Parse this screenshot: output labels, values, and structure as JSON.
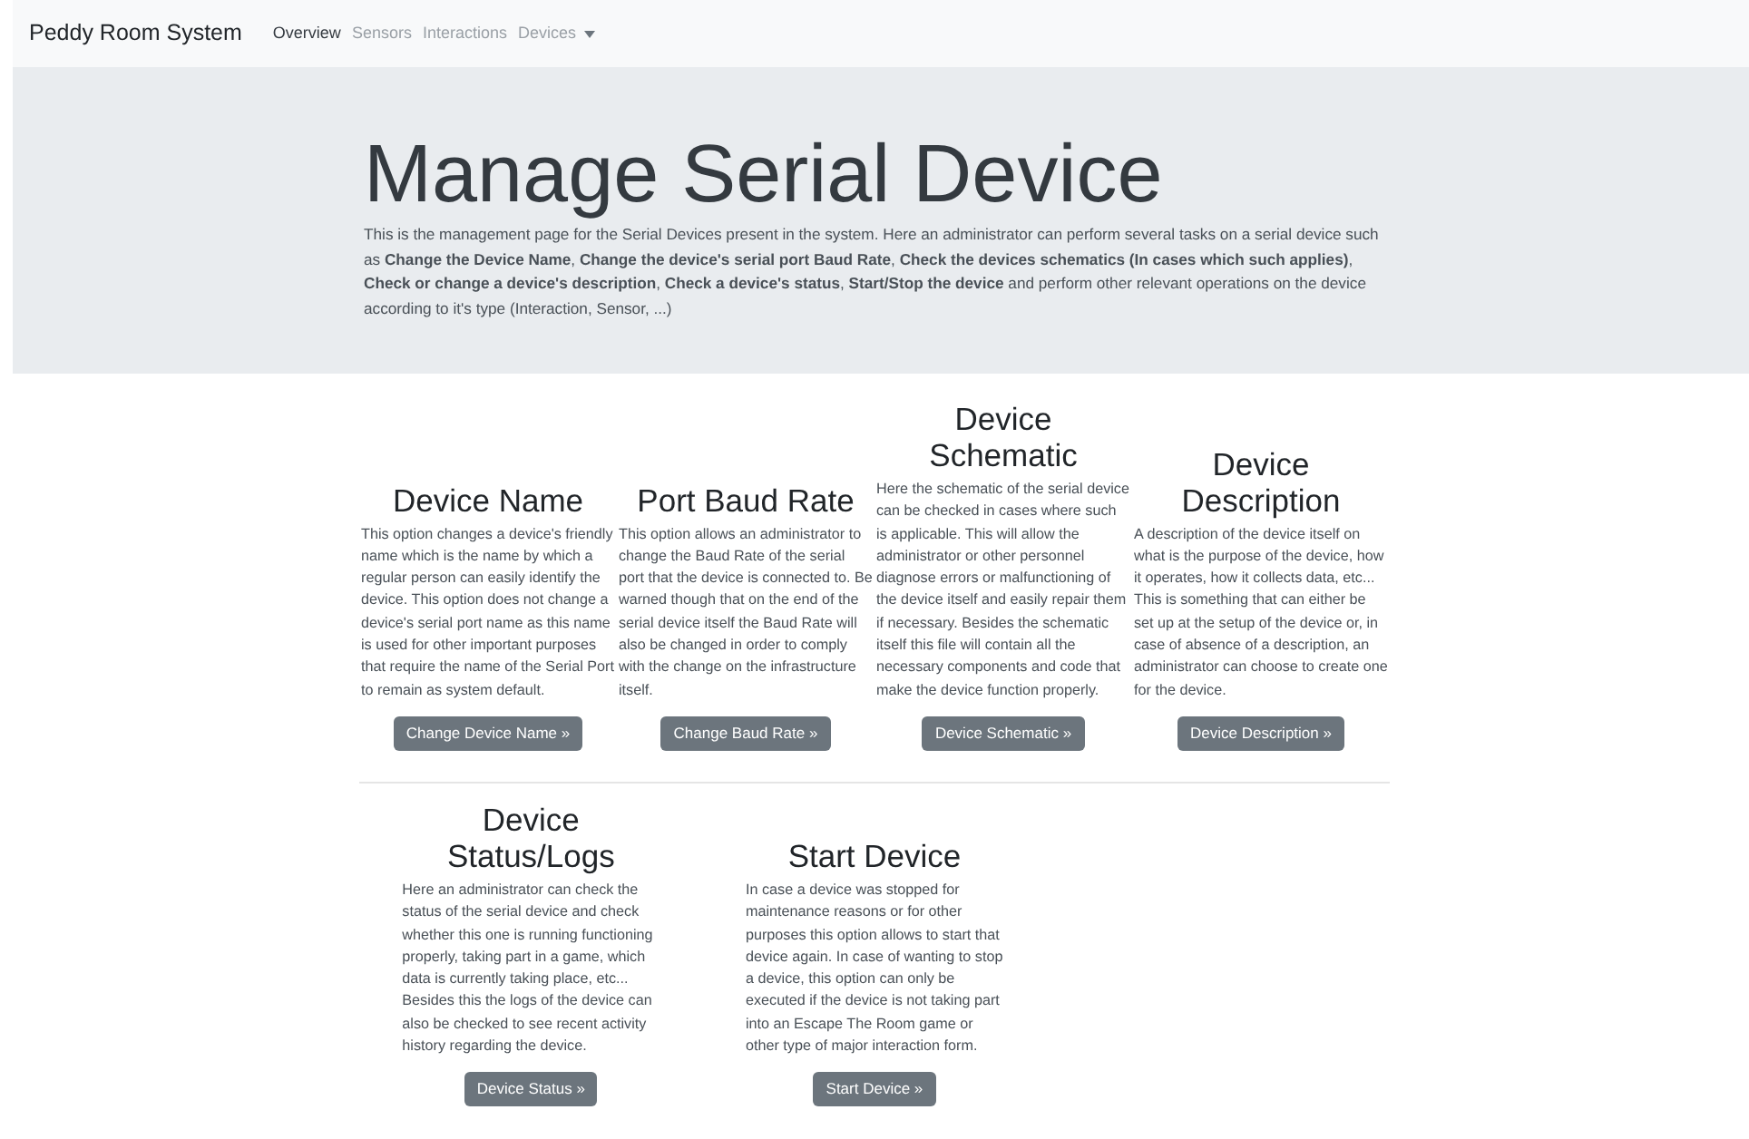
{
  "navbar": {
    "brand": "Peddy Room System",
    "items": [
      {
        "label": "Overview",
        "selected": true,
        "kind": "link"
      },
      {
        "label": "Sensors",
        "selected": false,
        "kind": "link"
      },
      {
        "label": "Interactions",
        "selected": false,
        "kind": "link"
      },
      {
        "label": "Devices",
        "selected": false,
        "kind": "dropdown"
      }
    ]
  },
  "jumbotron": {
    "title": "Manage Serial Device",
    "description": "This is the management page for the Serial Devices present in the system. Here an administrator can perform several tasks on a serial device such as **Change the Device Name**, **Change the device's serial port Baud Rate**, **Check the devices schematics (In cases which such applies)**, **Check or change a device's description**, **Check a device's status**, **Start/Stop the device** and perform other relevant operations on the device according to it's type (Interaction, Sensor, ...)"
  },
  "option_rows": [
    [
      {
        "heading": "Device Name",
        "text": "This option changes a device's friendly name which is the name by which a regular person can easily identify the device. This option does not change a device's serial port name as this name is used for other important purposes that require the name of the Serial Port to remain as system default.",
        "button": "Change Device Name »"
      },
      {
        "heading": "Port Baud Rate",
        "text": "This option allows an administrator to change the Baud Rate of the serial port that the device is connected to. Be warned though that on the end of the serial device itself the Baud Rate will also be changed in order to comply with the change on the infrastructure itself.",
        "button": "Change Baud Rate »"
      },
      {
        "heading": "Device Schematic",
        "text": "Here the schematic of the serial device can be checked in cases where such is applicable. This will allow the administrator or other personnel diagnose errors or malfunctioning of the device itself and easily repair them if necessary. Besides the schematic itself this file will contain all the necessary components and code that make the device function properly.",
        "button": "Device Schematic »"
      },
      {
        "heading": "Device Description",
        "text": "A description of the device itself on what is the purpose of the device, how it operates, how it collects data, etc... This is something that can either be set up at the setup of the device or, in case of absence of a description, an administrator can choose to create one for the device.",
        "button": "Device Description »"
      }
    ],
    [
      {
        "heading": "Device Status/Logs",
        "text": "Here an administrator can check the status of the serial device and check whether this one is running functioning properly, taking part in a game, which data is currently taking place, etc... Besides this the logs of the device can also be checked to see recent activity history regarding the device.",
        "button": "Device Status »"
      },
      {
        "heading": "Start Device",
        "text": "In case a device was stopped for maintenance reasons or for other purposes this option allows to start that device again. In case of wanting to stop a device, this option can only be executed if the device is not taking part into an Escape The Room game or other type of major interaction form.",
        "button": "Start Device »"
      }
    ]
  ]
}
